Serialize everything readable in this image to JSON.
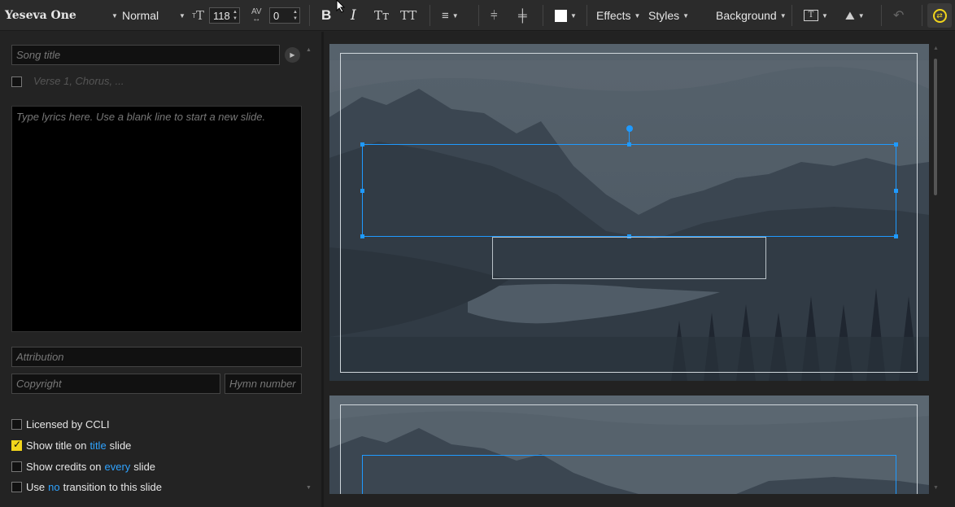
{
  "toolbar": {
    "font_family": "Yeseva One",
    "font_weight": "Normal",
    "font_size": "118",
    "letter_spacing": "0",
    "bold": "B",
    "italic": "I",
    "smallcaps": "Tт",
    "allcaps": "TT",
    "effects_label": "Effects",
    "styles_label": "Styles",
    "background_label": "Background",
    "text_color": "#ffffff",
    "accent_color": "#f2d51b"
  },
  "lyrics_panel": {
    "song_title_placeholder": "Song title",
    "section_placeholder": "Verse 1, Chorus, ...",
    "lyrics_placeholder": "Type lyrics here. Use a blank line to start a new slide.",
    "attribution_placeholder": "Attribution",
    "copyright_placeholder": "Copyright",
    "hymn_number_placeholder": "Hymn number"
  },
  "options": {
    "licensed_ccli": {
      "label": "Licensed by CCLI",
      "checked": false
    },
    "show_title": {
      "prefix": "Show title on",
      "link": "title",
      "suffix": "slide",
      "checked": true
    },
    "show_credits": {
      "prefix": "Show credits on",
      "link": "every",
      "suffix": "slide",
      "checked": false
    },
    "transition": {
      "prefix": "Use",
      "link": "no",
      "suffix": "transition to this slide",
      "checked": false
    }
  },
  "colors": {
    "selection": "#1f9aff",
    "highlight_link": "#2fa3ff"
  }
}
